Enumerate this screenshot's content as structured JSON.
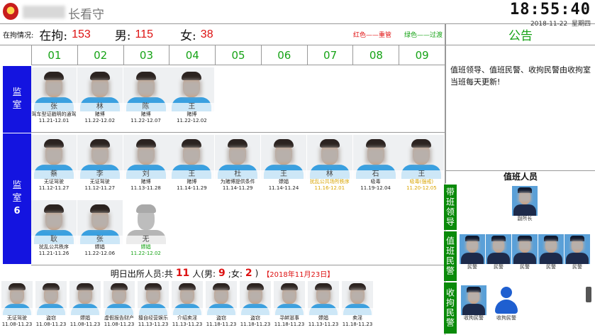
{
  "header": {
    "title_suffix": "长看守",
    "time": "18:55:40",
    "date": "2018-11-22",
    "weekday": "星期四"
  },
  "stats": {
    "in_custody_label": "在拘情况:",
    "in_custody_big": "在拘:",
    "in_custody_count": "153",
    "male_label": "男:",
    "male_count": "115",
    "female_label": "女:",
    "female_count": "38",
    "legend_red": "红色——重管",
    "legend_green": "绿色——过渡"
  },
  "columns": [
    "01",
    "02",
    "03",
    "04",
    "05",
    "06",
    "07",
    "08",
    "09"
  ],
  "rooms": [
    {
      "label_line1": "监",
      "label_line2": "室",
      "label_line3": "",
      "detainees": [
        {
          "name": "张",
          "crime": "驾车型证戳明的通驾",
          "dates": "11.21-12.01",
          "color": "normal"
        },
        {
          "name": "林",
          "crime": "赌博",
          "dates": "11.22-12.02",
          "color": "normal"
        },
        {
          "name": "陈",
          "crime": "赌博",
          "dates": "11.22-12.07",
          "color": "normal"
        },
        {
          "name": "王",
          "crime": "赌博",
          "dates": "11.22-12.02",
          "color": "normal"
        }
      ]
    },
    {
      "label_line1": "监",
      "label_line2": "室",
      "label_line3": "6",
      "detainees": [
        {
          "name": "蔡",
          "crime": "无证驾驶",
          "dates": "11.12-11.27",
          "color": "normal"
        },
        {
          "name": "李",
          "crime": "无证驾驶",
          "dates": "11.12-11.27",
          "color": "normal"
        },
        {
          "name": "刘",
          "crime": "赌博",
          "dates": "11.13-11.28",
          "color": "normal"
        },
        {
          "name": "王",
          "crime": "赌博",
          "dates": "11.14-11.29",
          "color": "normal"
        },
        {
          "name": "杜",
          "crime": "为赌博提供条件",
          "dates": "11.14-11.29",
          "color": "normal"
        },
        {
          "name": "王",
          "crime": "嫖娼",
          "dates": "11.14-11.24",
          "color": "normal"
        },
        {
          "name": "林",
          "crime": "扰乱公共场所秩序",
          "dates": "11.16-12.01",
          "color": "yellow"
        },
        {
          "name": "石",
          "crime": "吸毒",
          "dates": "11.19-12.04",
          "color": "normal"
        },
        {
          "name": "王",
          "crime": "吸毒(强戒)",
          "dates": "11.20-12.05",
          "color": "yellow"
        },
        {
          "name": "耿",
          "crime": "扰乱公共秩序",
          "dates": "11.21-11.26",
          "color": "normal"
        },
        {
          "name": "张",
          "crime": "嫖娼",
          "dates": "11.22-12.06",
          "color": "normal"
        },
        {
          "name": "无",
          "crime": "嫖娼",
          "dates": "11.22-12.02",
          "color": "green",
          "ghost": true
        }
      ]
    }
  ],
  "tomorrow": {
    "prefix": "明日出所人员:共",
    "total": "11",
    "unit": "人(男:",
    "male": "9",
    "sep": ";女:",
    "female": "2",
    "close": ")",
    "date": "【2018年11月23日】",
    "people": [
      {
        "crime": "无证驾驶",
        "dates": "11.08-11.23"
      },
      {
        "crime": "盗窃",
        "dates": "11.08-11.23"
      },
      {
        "crime": "嫖娼",
        "dates": "11.08-11.23"
      },
      {
        "crime": "虚假报告财产",
        "dates": "11.08-11.23"
      },
      {
        "crime": "擅自经营娱乐",
        "dates": "11.13-11.23"
      },
      {
        "crime": "介绍卖淫",
        "dates": "11.13-11.23"
      },
      {
        "crime": "盗窃",
        "dates": "11.18-11.23"
      },
      {
        "crime": "盗窃",
        "dates": "11.18-11.23"
      },
      {
        "crime": "寻衅滋事",
        "dates": "11.18-11.23"
      },
      {
        "crime": "嫖娼",
        "dates": "11.13-11.23"
      },
      {
        "crime": "卖淫",
        "dates": "11.18-11.23"
      }
    ]
  },
  "announcement": {
    "title": "公告",
    "text": "值班领导、值班民警、收拘民警由收拘室当班每天更新!"
  },
  "duty": {
    "title": "值班人员",
    "leader_label": "带班领导",
    "leader": [
      {
        "caption": "副所长"
      }
    ],
    "police_label": "值班民警",
    "police": [
      {
        "caption": "民警"
      },
      {
        "caption": "民警"
      },
      {
        "caption": "民警"
      },
      {
        "caption": "民警"
      },
      {
        "caption": "民警"
      }
    ],
    "intake_label": "收拘民警",
    "intake": [
      {
        "caption": "收拘民警",
        "photo": true
      },
      {
        "caption": "收拘民警",
        "photo": false
      }
    ]
  }
}
